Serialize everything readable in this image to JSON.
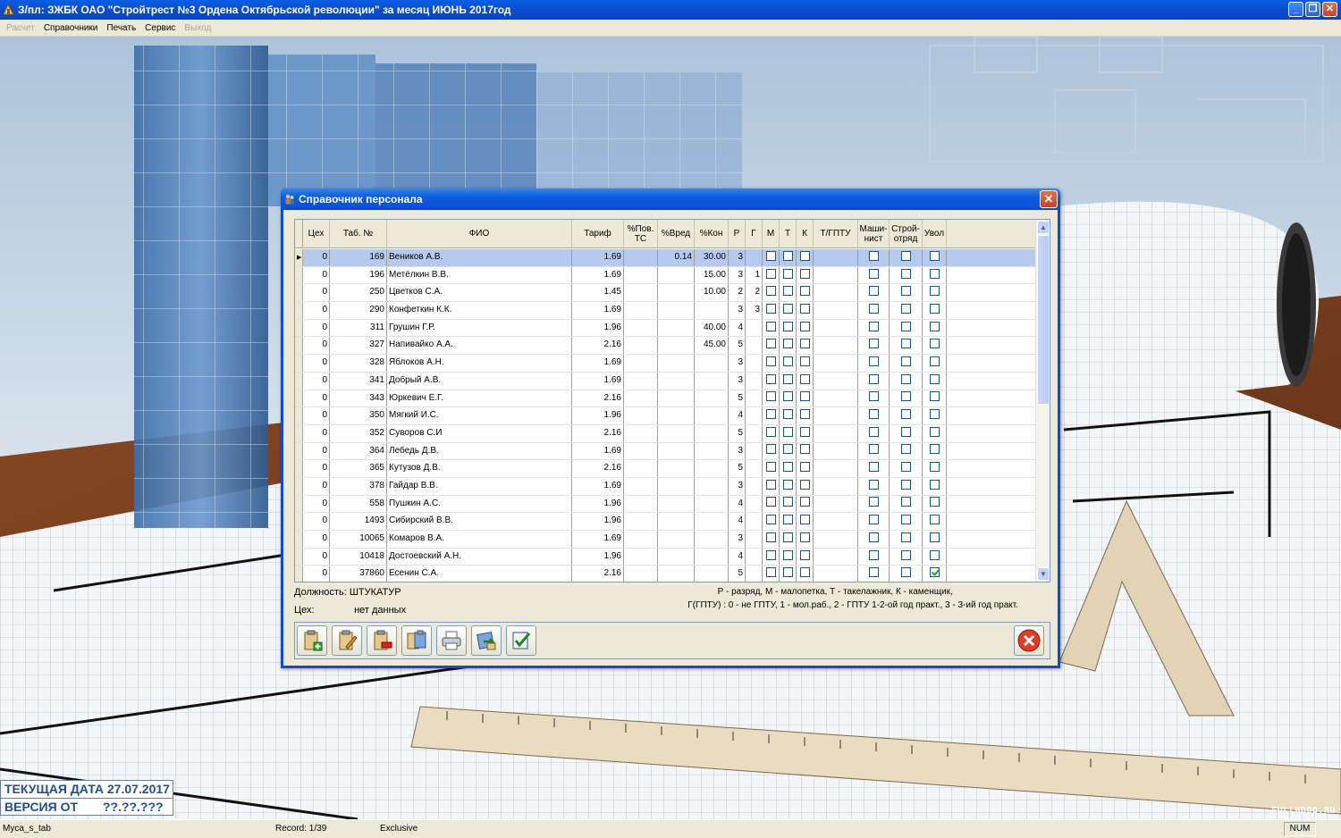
{
  "window": {
    "title": "З/пл: ЗЖБК ОАО \"Стройтрест №3 Ордена Октябрьской революции\" за месяц ИЮНЬ 2017год",
    "controls": [
      "minimize-icon",
      "restore-icon",
      "close-icon"
    ]
  },
  "menu": [
    {
      "label": "Расчет",
      "enabled": false
    },
    {
      "label": "Справочники",
      "enabled": true
    },
    {
      "label": "Печать",
      "enabled": true
    },
    {
      "label": "Сервис",
      "enabled": true
    },
    {
      "label": "Выход",
      "enabled": false
    }
  ],
  "dialog": {
    "title": "Справочник персонала",
    "columns": [
      "Цех",
      "Таб. №",
      "ФИО",
      "Тариф",
      "%Пов. ТС",
      "%Вред",
      "%Кон",
      "Р",
      "Г",
      "М",
      "Т",
      "К",
      "Т/ГПТУ",
      "Маши- нист",
      "Строй- отряд",
      "Увол"
    ],
    "rows": [
      {
        "ceh": "0",
        "tab": "169",
        "fio": "Веников А.В.",
        "tarif": "1.69",
        "pov": "",
        "vred": "0.14",
        "kon": "30.00",
        "r": "3",
        "g": "",
        "uvol": false,
        "selected": true
      },
      {
        "ceh": "0",
        "tab": "196",
        "fio": "Метёлкин В.В.",
        "tarif": "1.69",
        "pov": "",
        "vred": "",
        "kon": "15.00",
        "r": "3",
        "g": "1",
        "uvol": false
      },
      {
        "ceh": "0",
        "tab": "250",
        "fio": "Цветков С.А.",
        "tarif": "1.45",
        "pov": "",
        "vred": "",
        "kon": "10.00",
        "r": "2",
        "g": "2",
        "uvol": false
      },
      {
        "ceh": "0",
        "tab": "290",
        "fio": "Конфеткин К.К.",
        "tarif": "1.69",
        "pov": "",
        "vred": "",
        "kon": "",
        "r": "3",
        "g": "3",
        "uvol": false
      },
      {
        "ceh": "0",
        "tab": "311",
        "fio": "Грушин Г.Р.",
        "tarif": "1.96",
        "pov": "",
        "vred": "",
        "kon": "40.00",
        "r": "4",
        "g": "",
        "uvol": false
      },
      {
        "ceh": "0",
        "tab": "327",
        "fio": "Напивайко А.А.",
        "tarif": "2.16",
        "pov": "",
        "vred": "",
        "kon": "45.00",
        "r": "5",
        "g": "",
        "uvol": false
      },
      {
        "ceh": "0",
        "tab": "328",
        "fio": "Яблоков А.Н.",
        "tarif": "1.69",
        "pov": "",
        "vred": "",
        "kon": "",
        "r": "3",
        "g": "",
        "uvol": false
      },
      {
        "ceh": "0",
        "tab": "341",
        "fio": "Добрый А.В.",
        "tarif": "1.69",
        "pov": "",
        "vred": "",
        "kon": "",
        "r": "3",
        "g": "",
        "uvol": false
      },
      {
        "ceh": "0",
        "tab": "343",
        "fio": "Юркевич Е.Г.",
        "tarif": "2.16",
        "pov": "",
        "vred": "",
        "kon": "",
        "r": "5",
        "g": "",
        "uvol": false
      },
      {
        "ceh": "0",
        "tab": "350",
        "fio": "Мягкий И.С.",
        "tarif": "1.96",
        "pov": "",
        "vred": "",
        "kon": "",
        "r": "4",
        "g": "",
        "uvol": false
      },
      {
        "ceh": "0",
        "tab": "352",
        "fio": "Суворов С.И",
        "tarif": "2.16",
        "pov": "",
        "vred": "",
        "kon": "",
        "r": "5",
        "g": "",
        "uvol": false
      },
      {
        "ceh": "0",
        "tab": "364",
        "fio": "Лебедь Д.В.",
        "tarif": "1.69",
        "pov": "",
        "vred": "",
        "kon": "",
        "r": "3",
        "g": "",
        "uvol": false
      },
      {
        "ceh": "0",
        "tab": "365",
        "fio": "Кутузов Д.В.",
        "tarif": "2.16",
        "pov": "",
        "vred": "",
        "kon": "",
        "r": "5",
        "g": "",
        "uvol": false
      },
      {
        "ceh": "0",
        "tab": "378",
        "fio": "Гайдар В.В.",
        "tarif": "1.69",
        "pov": "",
        "vred": "",
        "kon": "",
        "r": "3",
        "g": "",
        "uvol": false
      },
      {
        "ceh": "0",
        "tab": "558",
        "fio": "Пушкин А.С.",
        "tarif": "1.96",
        "pov": "",
        "vred": "",
        "kon": "",
        "r": "4",
        "g": "",
        "uvol": false
      },
      {
        "ceh": "0",
        "tab": "1493",
        "fio": "Сибирский В.В.",
        "tarif": "1.96",
        "pov": "",
        "vred": "",
        "kon": "",
        "r": "4",
        "g": "",
        "uvol": false
      },
      {
        "ceh": "0",
        "tab": "10065",
        "fio": "Комаров В.А.",
        "tarif": "1.69",
        "pov": "",
        "vred": "",
        "kon": "",
        "r": "3",
        "g": "",
        "uvol": false
      },
      {
        "ceh": "0",
        "tab": "10418",
        "fio": "Достоевский А.Н.",
        "tarif": "1.96",
        "pov": "",
        "vred": "",
        "kon": "",
        "r": "4",
        "g": "",
        "uvol": false
      },
      {
        "ceh": "0",
        "tab": "37860",
        "fio": "Есенин С.А.",
        "tarif": "2.16",
        "pov": "",
        "vred": "",
        "kon": "",
        "r": "5",
        "g": "",
        "uvol": true
      }
    ],
    "position_label": "Должность:",
    "position_value": "ШТУКАТУР",
    "ceh_label": "Цех:",
    "ceh_value": "нет данных",
    "legend_line1": "Р - разряд, М - малопетка, Т - такелажник, К - каменщик,",
    "legend_line2": "Г(ГПТУ) : 0 - не ГПТУ, 1 - мол.раб., 2 - ГПТУ 1-2-ой год практ., 3 - 3-ий год практ.",
    "toolbar": [
      "add-record-icon",
      "edit-record-icon",
      "delete-record-icon",
      "copy-record-icon",
      "print-icon",
      "export-icon",
      "select-icon"
    ],
    "exit_icon": "exit-icon"
  },
  "date_panel": {
    "current_date": "ТЕКУЩАЯ ДАТА 27.07.2017",
    "version_label": "ВЕРСИЯ ОТ",
    "version_value": "??.??.???"
  },
  "watermark": "FULLHDOO.RU",
  "status": {
    "table": "Myca_s_tab",
    "record": "Record: 1/39",
    "mode": "Exclusive",
    "num": "NUM"
  },
  "colors": {
    "title_blue": "#0a47c2",
    "selected_row": "#b5caee",
    "date_text": "#1f4e93"
  }
}
